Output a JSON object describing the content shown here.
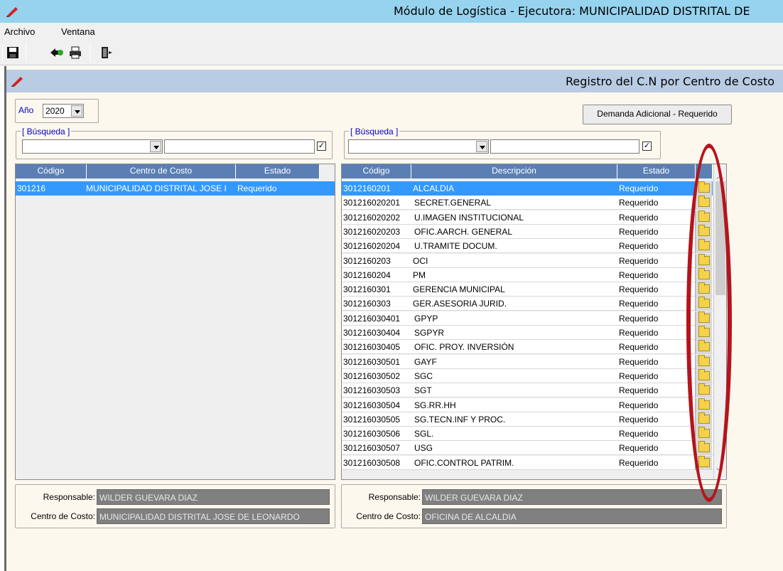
{
  "window": {
    "title": "Módulo de Logística - Ejecutora: MUNICIPALIDAD DISTRITAL DE"
  },
  "menu": {
    "items": [
      "Archivo",
      "Ventana"
    ]
  },
  "child": {
    "title": "Registro del C.N por Centro de Costo"
  },
  "year": {
    "label": "Año",
    "value": "2020"
  },
  "demand_button": "Demanda Adicional - Requerido",
  "left": {
    "search_label": "[ Búsqueda ]",
    "headers": [
      "Código",
      "Centro de Costo",
      "Estado"
    ],
    "rows": [
      {
        "code": "301216",
        "name": "MUNICIPALIDAD DISTRITAL JOSE I",
        "state": "Requerido"
      }
    ],
    "responsable_label": "Responsable:",
    "responsable_value": "WILDER GUEVARA DIAZ",
    "centro_label": "Centro de Costo:",
    "centro_value": "MUNICIPALIDAD DISTRITAL JOSE DE LEONARDO"
  },
  "right": {
    "search_label": "[ Búsqueda ]",
    "headers": [
      "Código",
      "Descripción",
      "Estado"
    ],
    "rows": [
      {
        "code": "3012160201",
        "desc": "ALCALDIA",
        "state": "Requerido"
      },
      {
        "code": "301216020201",
        "desc": "SECRET.GENERAL",
        "state": "Requerido"
      },
      {
        "code": "301216020202",
        "desc": "U.IMAGEN INSTITUCIONAL",
        "state": "Requerido"
      },
      {
        "code": "301216020203",
        "desc": "OFIC.AARCH. GENERAL",
        "state": "Requerido"
      },
      {
        "code": "301216020204",
        "desc": "U.TRAMITE DOCUM.",
        "state": "Requerido"
      },
      {
        "code": "3012160203",
        "desc": "OCI",
        "state": "Requerido"
      },
      {
        "code": "3012160204",
        "desc": "PM",
        "state": "Requerido"
      },
      {
        "code": "3012160301",
        "desc": "GERENCIA MUNICIPAL",
        "state": "Requerido"
      },
      {
        "code": "3012160303",
        "desc": "GER.ASESORIA JURID.",
        "state": "Requerido"
      },
      {
        "code": "301216030401",
        "desc": "GPYP",
        "state": "Requerido"
      },
      {
        "code": "301216030404",
        "desc": "SGPYR",
        "state": "Requerido"
      },
      {
        "code": "301216030405",
        "desc": "OFIC. PROY. INVERSIÓN",
        "state": "Requerido"
      },
      {
        "code": "301216030501",
        "desc": "GAYF",
        "state": "Requerido"
      },
      {
        "code": "301216030502",
        "desc": "SGC",
        "state": "Requerido"
      },
      {
        "code": "301216030503",
        "desc": "SGT",
        "state": "Requerido"
      },
      {
        "code": "301216030504",
        "desc": "SG.RR.HH",
        "state": "Requerido"
      },
      {
        "code": "301216030505",
        "desc": "SG.TECN.INF Y PROC.",
        "state": "Requerido"
      },
      {
        "code": "301216030506",
        "desc": "SGL.",
        "state": "Requerido"
      },
      {
        "code": "301216030507",
        "desc": "USG",
        "state": "Requerido"
      },
      {
        "code": "301216030508",
        "desc": "OFIC.CONTROL PATRIM.",
        "state": "Requerido"
      }
    ],
    "responsable_label": "Responsable:",
    "responsable_value": "WILDER GUEVARA DIAZ",
    "centro_label": "Centro de Costo:",
    "centro_value": "OFICINA DE ALCALDIA"
  },
  "colors": {
    "titlebar": "#96d3ee",
    "grid_header": "#5b7fb5",
    "selection": "#3399ff",
    "highlight_oval": "#b5141c"
  },
  "icons": [
    "pen-icon",
    "save-icon",
    "back-icon",
    "print-icon",
    "exit-icon",
    "folder-icon"
  ]
}
